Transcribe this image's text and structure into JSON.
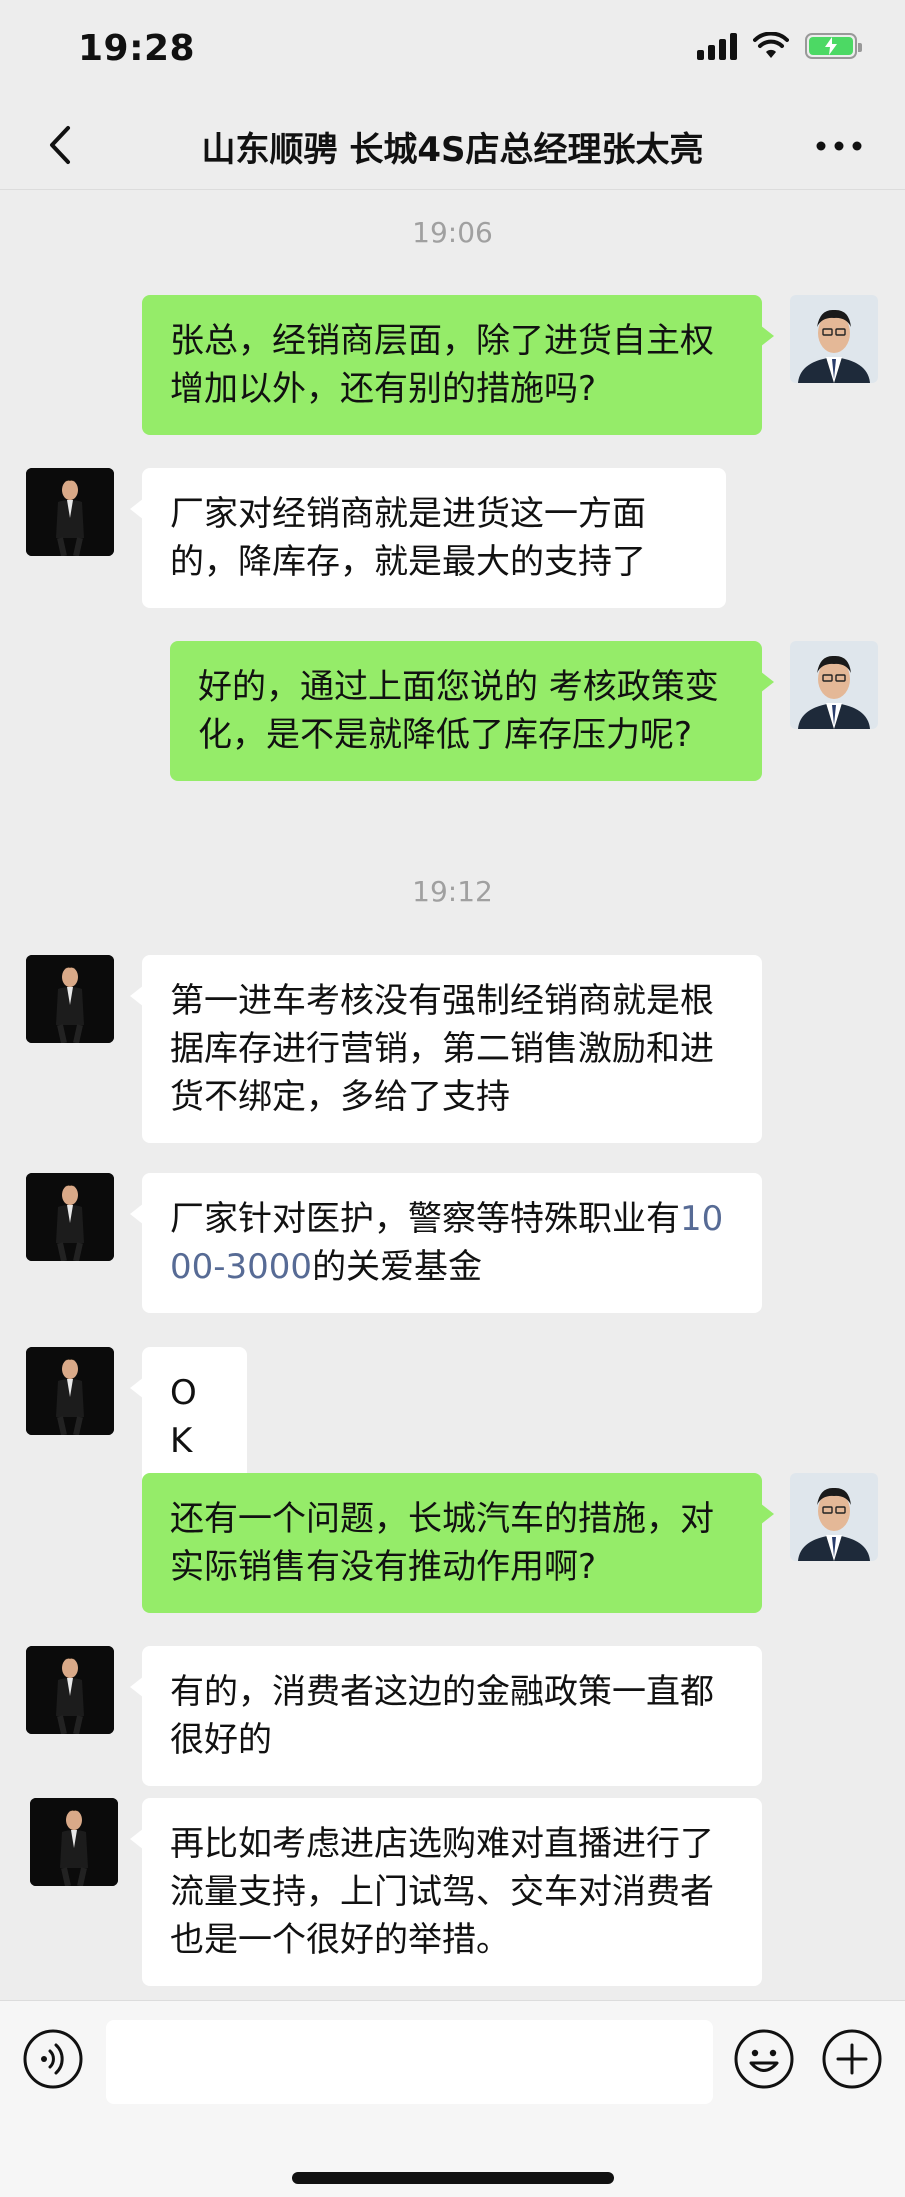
{
  "status_bar": {
    "time": "19:28"
  },
  "header": {
    "title": "山东顺骋 长城4S店总经理张太亮"
  },
  "messages": [
    {
      "text": "张总，经销商层面，除了进货自主权增加以外，还有别的措施吗?"
    },
    {
      "text": "厂家对经销商就是进货这一方面的，降库存，就是最大的支持了"
    },
    {
      "text": "好的，通过上面您说的 考核政策变化，是不是就降低了库存压力呢?"
    },
    {
      "text": "第一进车考核没有强制经销商就是根据库存进行营销，第二销售激励和进货不绑定，多给了支持"
    },
    {
      "text_before": "厂家针对医护，警察等特殊职业有",
      "link": "1000-3000",
      "text_after": "的关爱基金"
    },
    {
      "text": "OK"
    },
    {
      "text": "还有一个问题，长城汽车的措施，对实际销售有没有推动作用啊?"
    },
    {
      "text": "有的，消费者这边的金融政策一直都很好的"
    },
    {
      "text": "再比如考虑进店选购难对直播进行了流量支持，上门试驾、交车对消费者也是一个很好的举措。"
    }
  ],
  "timestamps": [
    "19:06",
    "19:12"
  ],
  "input": {
    "value": ""
  },
  "icons": {
    "back": "chevron-left-icon",
    "more": "more-dots-icon",
    "voice": "voice-icon",
    "emoji": "emoji-icon",
    "plus": "plus-icon"
  },
  "colors": {
    "background": "#ededed",
    "my_bubble": "#95ec69",
    "their_bubble": "#ffffff",
    "link": "#576b95",
    "timestamp": "#a0a0a0"
  }
}
